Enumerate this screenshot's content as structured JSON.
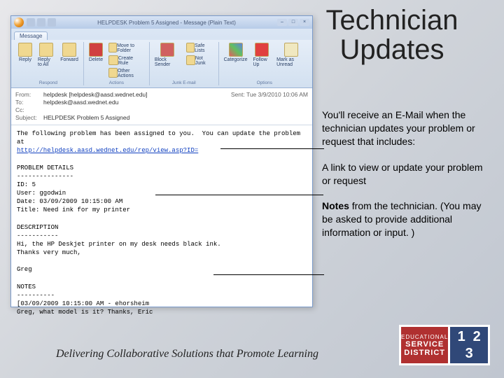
{
  "slide": {
    "title": "Technician Updates",
    "para1": "You'll receive an E-Mail when the technician updates your problem or request that includes:",
    "para2": "A link to view or update your problem or request",
    "para3_prefix": "Notes",
    "para3_rest": " from the technician. (You may be asked to provide additional information or input. )",
    "footer": "Delivering Collaborative Solutions that Promote Learning"
  },
  "logo": {
    "top": "EDUCATIONAL",
    "mid": "SERVICE",
    "bot": "DISTRICT",
    "d1": "1",
    "d2": "2",
    "d3": "3"
  },
  "email": {
    "title": "HELPDESK Problem 5 Assigned - Message (Plain Text)",
    "tab": "Message",
    "btn_reply": "Reply",
    "btn_replyall": "Reply to All",
    "btn_forward": "Forward",
    "btn_delete": "Delete",
    "btn_move": "Move to Folder",
    "btn_create": "Create Rule",
    "btn_other": "Other Actions",
    "btn_block": "Block Sender",
    "btn_safe": "Safe Lists",
    "btn_notjunk": "Not Junk",
    "btn_cat": "Categorize",
    "btn_follow": "Follow Up",
    "btn_unread": "Mark as Unread",
    "grp_respond": "Respond",
    "grp_actions": "Actions",
    "grp_junk": "Junk E-mail",
    "grp_options": "Options",
    "lbl_from": "From:",
    "lbl_to": "To:",
    "lbl_cc": "Cc:",
    "lbl_subject": "Subject:",
    "lbl_sent": "Sent:",
    "from": "helpdesk [helpdesk@aasd.wednet.edu]",
    "to": "helpdesk@aasd.wednet.edu",
    "subject": "HELPDESK Problem 5 Assigned",
    "sent": "Tue 3/9/2010 10:06 AM",
    "body_intro": "The following problem has been assigned to you.  You can update the problem at",
    "body_link": "http://helpdesk.aasd.wednet.edu/rep/view.asp?ID=",
    "body_rest": "PROBLEM DETAILS\n---------------\nID: 5\nUser: ggodwin\nDate: 03/09/2009 10:15:00 AM\nTitle: Need ink for my printer\n\nDESCRIPTION\n-----------\nHi, the HP Deskjet printer on my desk needs black ink.\nThanks very much,\n\nGreg\n\nNOTES\n----------\n[03/09/2009 10:15:00 AM - ehorsheim\nGreg, what model is it? Thanks, Eric"
  }
}
